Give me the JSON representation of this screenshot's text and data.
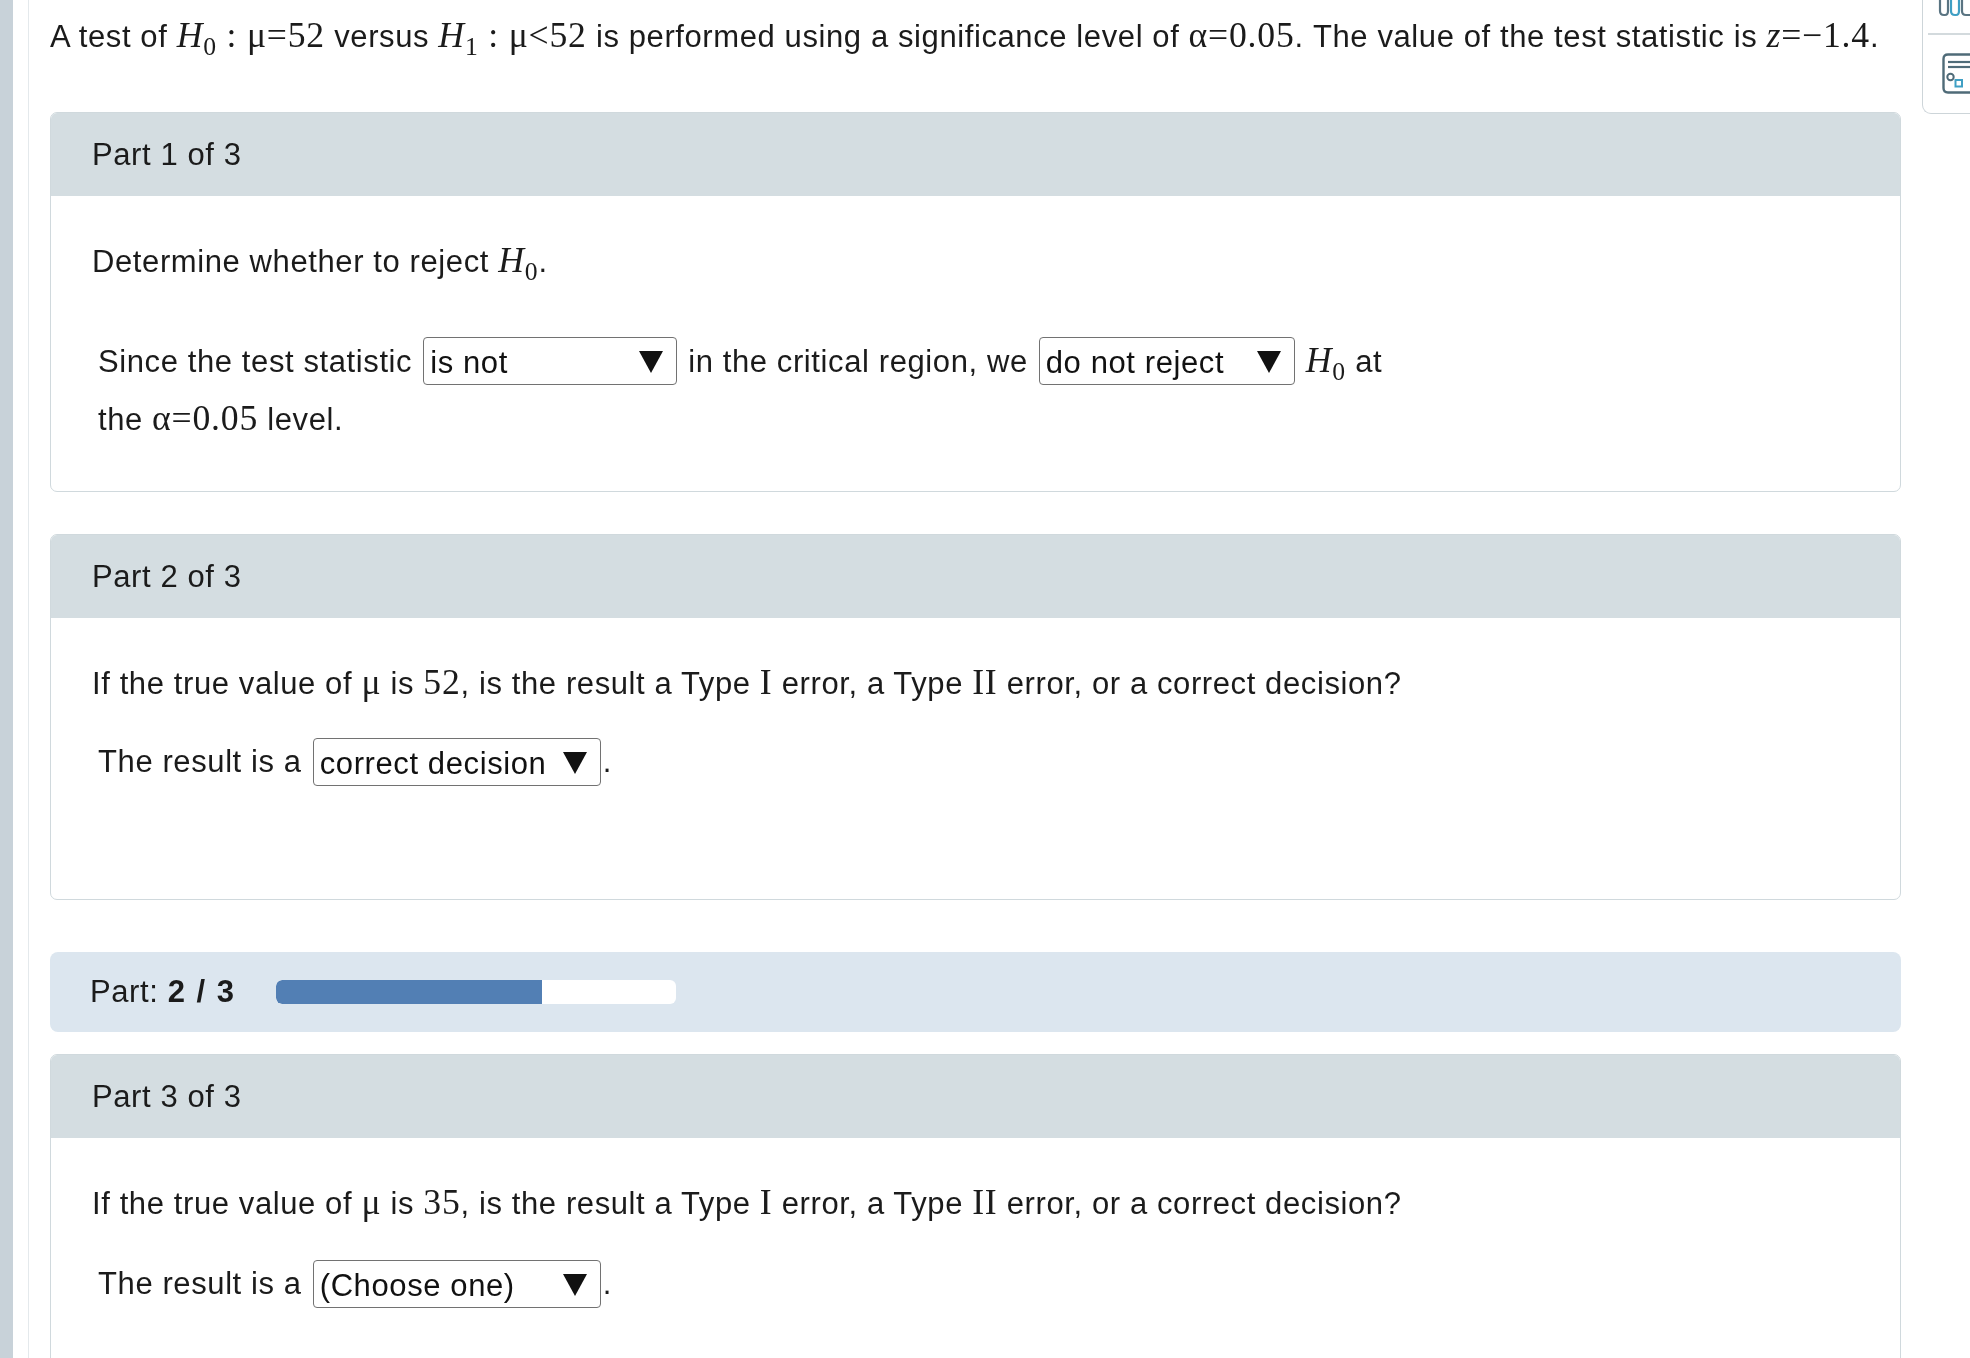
{
  "statement": [
    {
      "kind": "plain",
      "text": "A test of "
    },
    {
      "kind": "math",
      "text": "*H*$_{0}$ : μ=52"
    },
    {
      "kind": "plain",
      "text": " versus "
    },
    {
      "kind": "math",
      "text": "*H*$_{1}$ : μ<52"
    },
    {
      "kind": "plain",
      "text": " is performed using a significance level of "
    },
    {
      "kind": "math",
      "text": "α=0.05"
    },
    {
      "kind": "plain",
      "text": ". The value of the test statistic is "
    },
    {
      "kind": "math",
      "text": "*z*=−1.4"
    },
    {
      "kind": "plain",
      "text": "."
    }
  ],
  "sections": [
    {
      "kind": "part",
      "header": "Part 1 of 3",
      "question": [
        {
          "kind": "plain",
          "text": "Determine whether to reject "
        },
        {
          "kind": "math",
          "text": "*H*$_{0}$"
        },
        {
          "kind": "plain",
          "text": "."
        }
      ],
      "answer": [
        {
          "kind": "text",
          "runs": [
            {
              "kind": "plain",
              "text": "Since the test statistic"
            }
          ]
        },
        {
          "kind": "select",
          "value": "is not"
        },
        {
          "kind": "text",
          "runs": [
            {
              "kind": "plain",
              "text": "in the critical region, we"
            }
          ]
        },
        {
          "kind": "select",
          "value": "do not reject"
        },
        {
          "kind": "text",
          "runs": [
            {
              "kind": "math",
              "text": "*H*$_{0}$"
            },
            {
              "kind": "plain",
              "text": " at"
            }
          ]
        },
        {
          "kind": "text",
          "runs": [
            {
              "kind": "plain",
              "text": "the "
            },
            {
              "kind": "math",
              "text": "α=0.05"
            },
            {
              "kind": "plain",
              "text": " level."
            }
          ]
        }
      ]
    },
    {
      "kind": "part",
      "header": "Part 2 of 3",
      "question": [
        {
          "kind": "plain",
          "text": "If the true value of "
        },
        {
          "kind": "math",
          "text": "μ"
        },
        {
          "kind": "plain",
          "text": " is "
        },
        {
          "kind": "math",
          "text": "52"
        },
        {
          "kind": "plain",
          "text": ", is the result a Type "
        },
        {
          "kind": "math",
          "text": "I"
        },
        {
          "kind": "plain",
          "text": " error, a Type "
        },
        {
          "kind": "math",
          "text": "II"
        },
        {
          "kind": "plain",
          "text": " error, or a correct decision?"
        }
      ],
      "answer": [
        {
          "kind": "text",
          "runs": [
            {
              "kind": "plain",
              "text": "The result is a"
            }
          ]
        },
        {
          "kind": "select",
          "value": "correct decision",
          "after": "."
        }
      ]
    },
    {
      "kind": "progress",
      "label": "Part: **2 / 3**",
      "level": 0.665
    },
    {
      "kind": "part",
      "header": "Part 3 of 3",
      "question": [
        {
          "kind": "plain",
          "text": "If the true value of "
        },
        {
          "kind": "math",
          "text": "μ"
        },
        {
          "kind": "plain",
          "text": " is "
        },
        {
          "kind": "math",
          "text": "35"
        },
        {
          "kind": "plain",
          "text": ", is the result a Type "
        },
        {
          "kind": "math",
          "text": "I"
        },
        {
          "kind": "plain",
          "text": " error, a Type "
        },
        {
          "kind": "math",
          "text": "II"
        },
        {
          "kind": "plain",
          "text": " error, or a correct decision?"
        }
      ],
      "answer": [
        {
          "kind": "text",
          "runs": [
            {
              "kind": "plain",
              "text": "The result is a"
            }
          ]
        },
        {
          "kind": "select",
          "value": "(Choose one)",
          "after": "."
        }
      ]
    }
  ]
}
